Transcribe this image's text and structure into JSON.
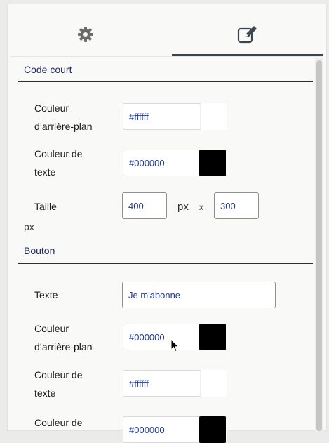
{
  "tabs": [
    {
      "name": "settings",
      "icon": "gear-icon",
      "active": false
    },
    {
      "name": "edit",
      "icon": "edit-icon",
      "active": true
    }
  ],
  "shortcode": {
    "title": "Code court",
    "bg_label_1": "Couleur",
    "bg_label_2": "d’arrière-plan",
    "bg_value": "#ffffff",
    "text_label_1": "Couleur de",
    "text_label_2": "texte",
    "text_value": "#000000",
    "size_label": "Taille",
    "width": "400",
    "px_unit": "px",
    "times": "x",
    "height": "300",
    "px_trailing": "px"
  },
  "button": {
    "title": "Bouton",
    "text_label": "Texte",
    "text_value": "Je m'abonne",
    "bg_label_1": "Couleur",
    "bg_label_2": "d’arrière-plan",
    "bg_value": "#000000",
    "fg_label_1": "Couleur de",
    "fg_label_2": "texte",
    "fg_value": "#ffffff",
    "border_label_1": "Couleur de",
    "border_value": "#000000"
  },
  "colors": {
    "accent": "#1e2a6b",
    "tab_indicator": "#3d4650",
    "black_swatch": "#000000",
    "white_swatch": "#ffffff"
  }
}
